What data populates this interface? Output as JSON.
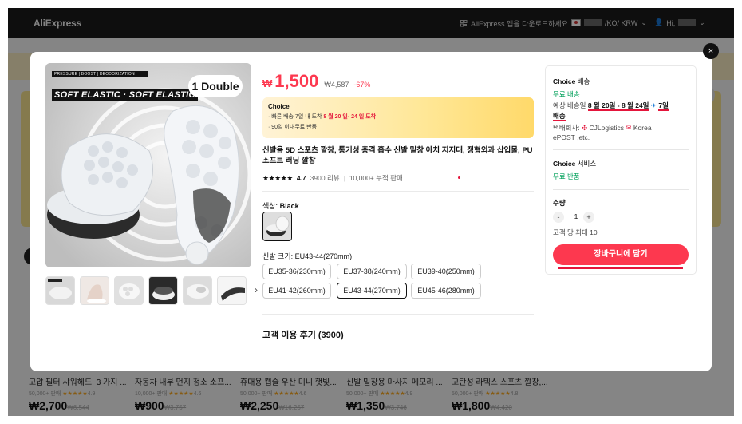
{
  "header": {
    "logo": "AliExpress",
    "app_download": "AliExpress 앱을 다운로드하세요",
    "region": "/KO/ KRW",
    "account": "Hi,"
  },
  "background_products": [
    {
      "title": "고압 필터 샤워헤드, 3 가지 ...",
      "sold": "50,000+ 판매",
      "rating": "4.9",
      "price": "₩2,700",
      "orig": "₩6,544"
    },
    {
      "title": "자동차 내부 먼지 청소 소프...",
      "sold": "10,000+ 판매",
      "rating": "4.6",
      "price": "₩900",
      "orig": "₩3,757"
    },
    {
      "title": "휴대용 캡슐 우산 미니 햇빛...",
      "sold": "50,000+ 판매",
      "rating": "4.6",
      "price": "₩2,250",
      "orig": "₩16,257"
    },
    {
      "title": "신발 밑창용 마사지 메모리 ...",
      "sold": "50,000+ 판매",
      "rating": "4.9",
      "price": "₩1,350",
      "orig": "₩3,746"
    },
    {
      "title": "고탄성 라텍스 스포츠 깔창,...",
      "sold": "50,000+ 판매",
      "rating": "4.8",
      "price": "₩1,800",
      "orig": "₩4,420"
    }
  ],
  "modal": {
    "close_icon": "×",
    "image": {
      "badge": "1 Double",
      "banner": "SOFT ELASTIC · SOFT ELASTIC",
      "tagline": "PRESSURE | BOOST | DEODORIZATION"
    },
    "thumb_next": "›",
    "price": {
      "currency": "₩",
      "value": "1,500",
      "original": "₩4,587",
      "discount": "-67%"
    },
    "choice": {
      "logo": "Choice",
      "line1_prefix": "· 빠른 배송 7일 내 도착",
      "line1_dates": "8 월 20 일- 24 일 도착",
      "line2": "· 90일 이내무료 반품"
    },
    "title": "신발용 5D 스포츠 깔창, 통기성 충격 흡수 신발 밑창 아치 지지대, 정형외과 삽입물, PU 소프트 러닝 깔창",
    "stars": "★★★★★",
    "rating": "4.7",
    "reviews_count": "3900 리뷰",
    "sold": "10,000+ 누적 판매",
    "color_label": "색상:",
    "color_value": "Black",
    "size_label": "신발 크기: EU43-44(270mm)",
    "sizes": [
      "EU35-36(230mm)",
      "EU37-38(240mm)",
      "EU39-40(250mm)",
      "EU41-42(260mm)",
      "EU43-44(270mm)",
      "EU45-46(280mm)"
    ],
    "selected_size": "EU43-44(270mm)",
    "reviews_heading": "고객 이용 후기 (3900)"
  },
  "right_panel": {
    "shipping_head": "Choice",
    "shipping_head_sub": "배송",
    "free_shipping": "무료 배송",
    "eta_label": "예상 배송일",
    "eta_dates": "8 월 20일 - 8 월 24일",
    "eta_plane": "✈",
    "eta_days": "7일",
    "eta_suffix": "배송",
    "carrier_label": "택배회사:",
    "carrier_names": "CJLogistics",
    "carrier_korea": "Korea",
    "carrier_epost": "ePOST ,etc.",
    "service_head": "Choice",
    "service_head_sub": "서비스",
    "free_return": "무료 반품",
    "qty_label": "수량",
    "qty_minus": "-",
    "qty_value": "1",
    "qty_plus": "+",
    "max_per_customer": "고객 당 최대 10",
    "add_to_cart": "장바구니에 담기"
  },
  "colors": {
    "accent": "#fd384f",
    "choice_gradient_start": "#fff3d6",
    "choice_gradient_end": "#ffd96a",
    "free_green": "#00a05a"
  }
}
